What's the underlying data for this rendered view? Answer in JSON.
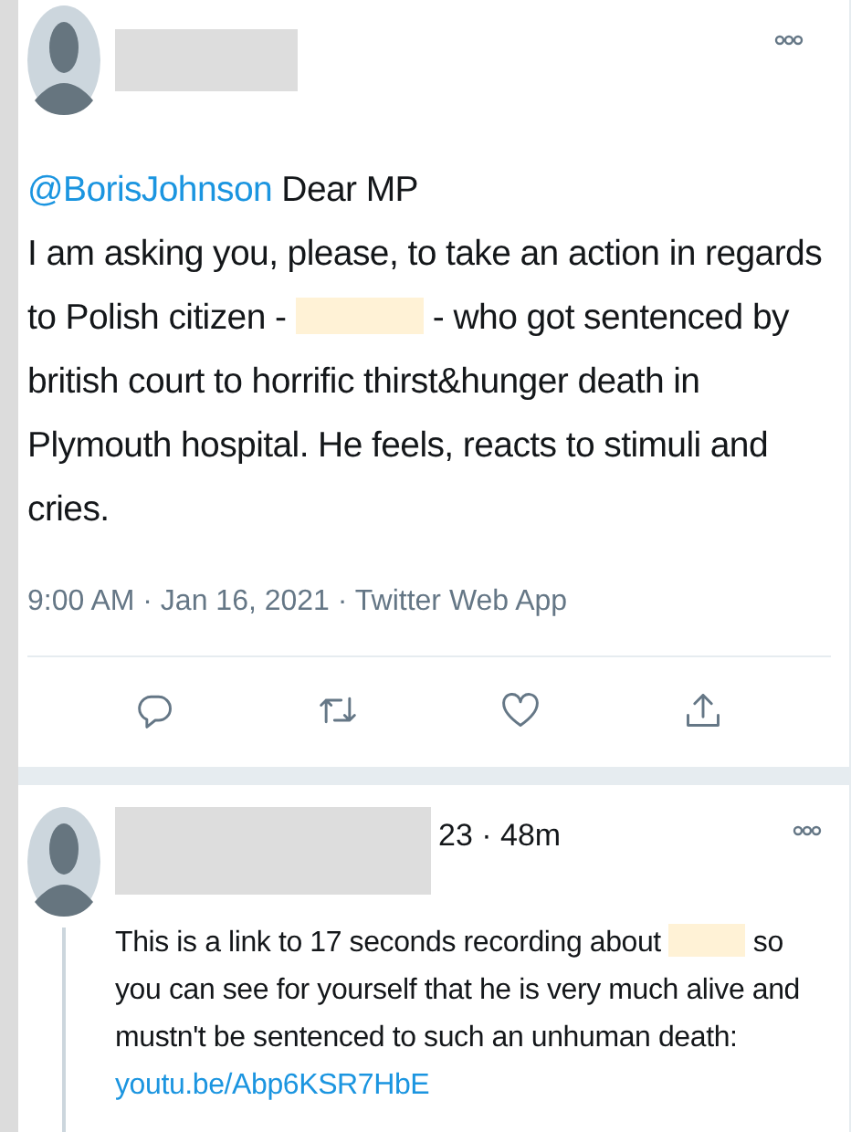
{
  "tweet": {
    "author": {
      "redacted": true
    },
    "body": [
      {
        "kind": "mention",
        "text": "@BorisJohnson"
      },
      {
        "kind": "text",
        "text": " Dear MP"
      },
      {
        "kind": "break"
      },
      {
        "kind": "text",
        "text": "I am asking you, please, to take an action in regards to Polish citizen - "
      },
      {
        "kind": "redaction"
      },
      {
        "kind": "text",
        "text": " - who got sentenced by british court to horrific thirst&hunger death in Plymouth hospital. He feels, reacts to stimuli and cries."
      }
    ],
    "timestamp": "9:00 AM · Jan 16, 2021 · Twitter Web App",
    "actions": [
      {
        "kind": "reply"
      },
      {
        "kind": "retweet"
      },
      {
        "kind": "like"
      },
      {
        "kind": "share"
      }
    ]
  },
  "reply": {
    "author": {
      "redacted": true
    },
    "meta": "23 · 48m",
    "body": [
      {
        "kind": "text",
        "text": "This is a link to 17 seconds recording about "
      },
      {
        "kind": "redaction"
      },
      {
        "kind": "text",
        "text": " so you can see for yourself that he is very much alive and mustn't be sentenced to such an unhuman death: "
      },
      {
        "kind": "link",
        "text": "youtu.be/Abp6KSR7HbE"
      }
    ]
  }
}
